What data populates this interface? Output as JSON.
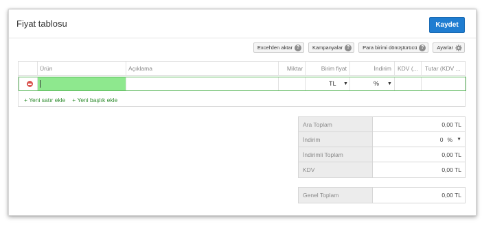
{
  "header": {
    "title": "Fiyat tablosu",
    "save_label": "Kaydet"
  },
  "toolbar": {
    "excel_import": "Excel'den aktar",
    "campaigns": "Kampanyalar",
    "currency_converter": "Para birimi dönüştürücü",
    "settings": "Ayarlar"
  },
  "grid": {
    "columns": [
      "Ürün",
      "Açıklama",
      "Miktar",
      "Birim fiyat",
      "İndirim",
      "KDV (...",
      "Tutar (KDV ..."
    ],
    "row": {
      "product": "",
      "description": "",
      "quantity": "",
      "currency": "TL",
      "discount_type": "%"
    }
  },
  "links": {
    "add_row": "+ Yeni satır ekle",
    "add_header": "+ Yeni başlık ekle"
  },
  "totals": {
    "subtotal_label": "Ara Toplam",
    "subtotal_value": "0,00 TL",
    "discount_label": "İndirim",
    "discount_value": "0",
    "discount_unit": "%",
    "discounted_label": "İndirimli Toplam",
    "discounted_value": "0,00 TL",
    "vat_label": "KDV",
    "vat_value": "0,00 TL",
    "grand_label": "Genel Toplam",
    "grand_value": "0,00 TL"
  },
  "colors": {
    "accent": "#1f7dd1",
    "active_row_border": "#5cb85c",
    "active_cell": "#8ee88e",
    "link": "#2e8b2e"
  }
}
